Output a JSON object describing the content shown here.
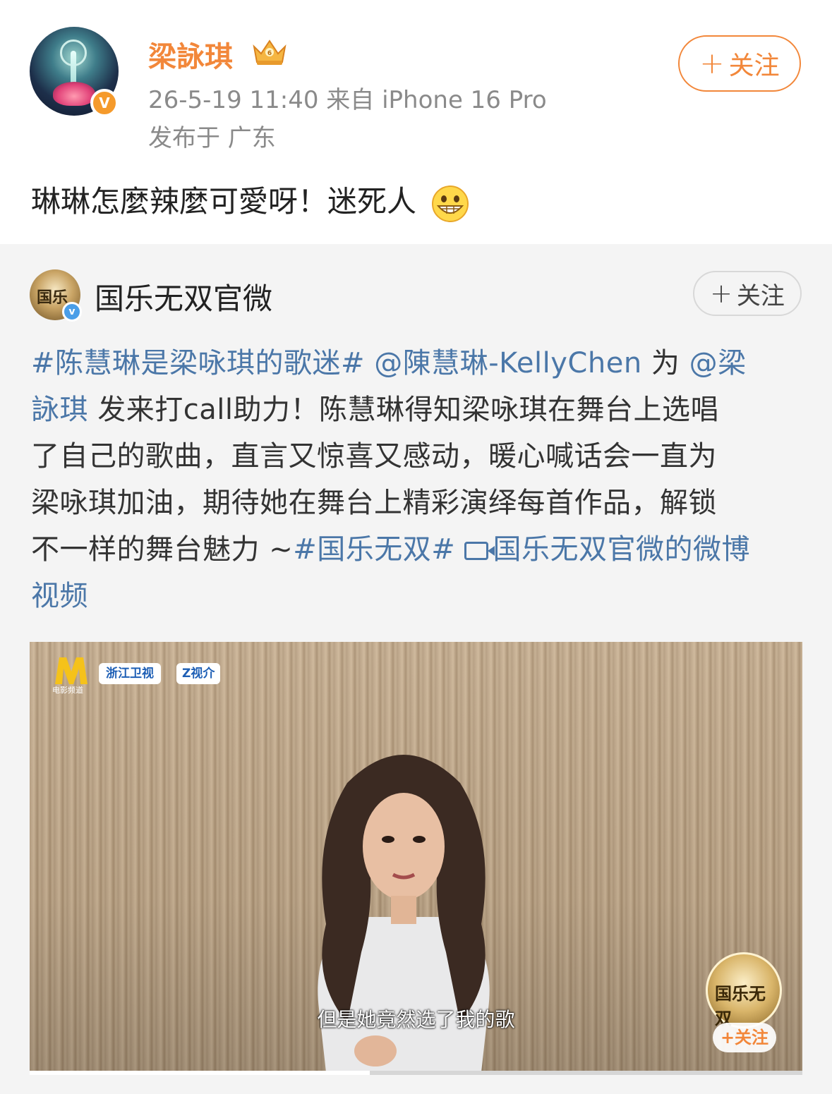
{
  "post": {
    "username": "梁詠琪",
    "verified_badge": "V",
    "crown_icon": "crown-icon",
    "timestamp_source": "26-5-19 11:40   来自 iPhone 16 Pro",
    "location": "发布于 广东",
    "follow_label": "关注",
    "text": "琳琳怎麼辣麼可愛呀！迷死人",
    "emoji": "grin-emoji"
  },
  "repost": {
    "author": "国乐无双官微",
    "verified_badge": "v",
    "follow_label": "关注",
    "text_lines": [
      [
        {
          "t": "#陈慧琳是梁咏琪的歌迷#",
          "link": true
        },
        {
          "t": " @陳慧琳-KellyChen",
          "link": true
        },
        {
          "t": " 为 ",
          "link": false
        },
        {
          "t": "@梁",
          "link": true
        }
      ],
      [
        {
          "t": "詠琪",
          "link": true
        },
        {
          "t": " 发来打call助力！陈慧琳得知梁咏琪在舞台上选唱",
          "link": false
        }
      ],
      [
        {
          "t": "了自己的歌曲，直言又惊喜又感动，暖心喊话会一直为",
          "link": false
        }
      ],
      [
        {
          "t": "梁咏琪加油，期待她在舞台上精彩演绎每首作品，解锁",
          "link": false
        }
      ],
      [
        {
          "t": "不一样的舞台魅力 ~",
          "link": false
        },
        {
          "t": "#国乐无双#",
          "link": true
        },
        {
          "t": " ",
          "link": false
        },
        {
          "t": "国乐无双官微的微博",
          "link": true,
          "icon": "video-icon"
        }
      ],
      [
        {
          "t": "视频",
          "link": true
        }
      ]
    ]
  },
  "video": {
    "logo_caption": "电影频道",
    "tag1": "浙江卫视",
    "tag2": "Z视介",
    "subtitle": "但是她竟然选了我的歌",
    "badge_text": "国乐无双",
    "follow_label": "+关注",
    "progress": 0.44
  }
}
